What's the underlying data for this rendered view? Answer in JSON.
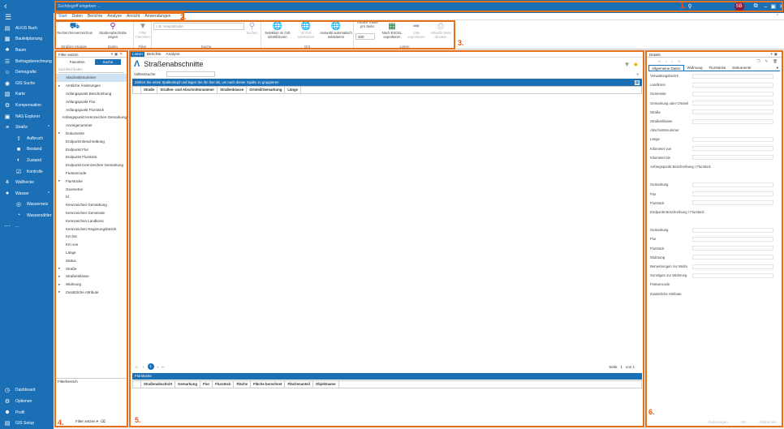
{
  "nav": {
    "items": [
      {
        "icon": "doc",
        "label": "ALKIS Buch"
      },
      {
        "icon": "plan",
        "label": "Bauleitplanung"
      },
      {
        "icon": "tree",
        "label": "Baum"
      },
      {
        "icon": "calc",
        "label": "Beitragsberechnung"
      },
      {
        "icon": "person",
        "label": "Demografie"
      },
      {
        "icon": "pin",
        "label": "GIS Suche"
      },
      {
        "icon": "map",
        "label": "Karte"
      },
      {
        "icon": "gear",
        "label": "Kompensation"
      },
      {
        "icon": "nas",
        "label": "NAS Explorer"
      },
      {
        "icon": "road",
        "label": "Straße",
        "caret": "^"
      },
      {
        "icon": "up",
        "label": "Aufbruch",
        "sub": true
      },
      {
        "icon": "box",
        "label": "Bestand",
        "sub": true
      },
      {
        "icon": "state",
        "label": "Zustand",
        "sub": true
      },
      {
        "icon": "check",
        "label": "Kontrolle",
        "sub": true
      },
      {
        "icon": "hedge",
        "label": "Wallhecke"
      },
      {
        "icon": "drop",
        "label": "Wasser",
        "caret": "^"
      },
      {
        "icon": "net",
        "label": "Wassernetz",
        "sub": true
      },
      {
        "icon": "meter",
        "label": "Wasserzähler",
        "sub": true
      },
      {
        "icon": "more",
        "label": "..."
      }
    ],
    "bottom": [
      {
        "icon": "dash",
        "label": "Dashboard"
      },
      {
        "icon": "opt",
        "label": "Optionen"
      },
      {
        "icon": "prof",
        "label": "Profil"
      },
      {
        "icon": "setup",
        "label": "GIS Setup"
      }
    ]
  },
  "topbar": {
    "search_placeholder": "Suchbegriff eingeben ...",
    "avatar": "SB"
  },
  "menu": [
    "Start",
    "Daten",
    "Berichte",
    "Analyse",
    "Ansicht",
    "Anwendungen"
  ],
  "ribbon": {
    "b_recherche": "Recherchenverzeichnis",
    "b_abschnitte": "Straßenabschnitte zeigen",
    "g_module": "Straßen Module",
    "g_daten": "Daten",
    "b_filter": "Filter Favoriten",
    "g_filter": "Filter",
    "ph_hauptstrasse": "z.B. Hauptstraße",
    "b_suchen": "Suchen",
    "g_suche": "Suche",
    "b_selektion": "Selektion im GIS identifizieren",
    "b_gis_sel": "Im GIS selektieren",
    "b_auswahl": "Auswahl automatisch selektieren",
    "g_gis": "GIS",
    "treffer_label": "Anzahl Treffer pro Seite:",
    "treffer_value": "100",
    "b_excel": "Nach EXCEL exportieren",
    "b_liste": "Liste exportieren",
    "b_drucken": "Aktuelle Seite drucken",
    "g_listen": "Listen"
  },
  "filter": {
    "title": "Filter setzen",
    "tab_fav": "Favoriten",
    "tab_suche": "Suche",
    "search_ph": "Suchfeld finden",
    "items": [
      {
        "label": "Abschnittsnummer",
        "sel": true
      },
      {
        "label": "Amtliche Änderungen",
        "exp": true
      },
      {
        "label": "Anfangspunkt Beschreibung"
      },
      {
        "label": "Anfangspunkt Flur"
      },
      {
        "label": "Anfangspunkt Flurstück"
      },
      {
        "label": "Anfangspunkt Kennzeichen Gemarkung"
      },
      {
        "label": "Anzeigenummer"
      },
      {
        "label": "Dokumente",
        "exp": true
      },
      {
        "label": "Endpunkt Beschreibung"
      },
      {
        "label": "Endpunkt Flur"
      },
      {
        "label": "Endpunkt Flurstück"
      },
      {
        "label": "Endpunkt Kennzeichen Gemarkung"
      },
      {
        "label": "Featurecode"
      },
      {
        "label": "Flurstücke",
        "exp": true
      },
      {
        "label": "Geometrie"
      },
      {
        "label": "Id"
      },
      {
        "label": "Kennzeichen Gemarkung"
      },
      {
        "label": "Kennzeichen Gemeinde"
      },
      {
        "label": "Kennzeichen Landkreis"
      },
      {
        "label": "Kennzeichen Regierungsbezirk"
      },
      {
        "label": "Km bis"
      },
      {
        "label": "Km von"
      },
      {
        "label": "Länge"
      },
      {
        "label": "Status"
      },
      {
        "label": "Straße",
        "exp": true
      },
      {
        "label": "Straßenklasse",
        "exp": true
      },
      {
        "label": "Widmung",
        "exp": true
      },
      {
        "label": "Zusätzliche Attribute",
        "exp": true
      }
    ],
    "filterbereich": "Filterbereich",
    "set_btn": "Filter setzen"
  },
  "main": {
    "tabs": [
      "Listen",
      "Berichte",
      "Analyse"
    ],
    "title": "Straßenabschnitte",
    "volltext": "Volltextsuche",
    "group_hint": "Ziehen Sie einen Spaltenkopf und legen Sie ihn hier ab, um nach dieser Spalte zu gruppieren",
    "columns": [
      "Straße",
      "Straßen- und Abschnittsnummer",
      "Straßenklasse",
      "Ortsteil/Gemarkung",
      "Länge"
    ],
    "pager_page": "1",
    "pager_text": "Seite",
    "pager_of": "von 1",
    "sub_title": "Flurstücke",
    "sub_columns": [
      "Straßenabschnitt",
      "Gemarkung",
      "Flur",
      "Flurstück",
      "Fläche",
      "Fläche berechnet",
      "Flächenanteil",
      "Objektname"
    ]
  },
  "details": {
    "title": "Details",
    "tabs": [
      "Allgemeine Daten",
      "Widmung",
      "Flurstücke",
      "Dokumente"
    ],
    "rows": [
      {
        "label": "Verwaltungsbezirk",
        "f": true
      },
      {
        "label": "Landkreis",
        "f": true
      },
      {
        "label": "Gemeinde",
        "f": true
      },
      {
        "label": "Gemarkung oder Ortsteil",
        "f": true
      },
      {
        "label": "Straße",
        "f": true
      },
      {
        "label": "Straßenklasse",
        "f": true
      },
      {
        "label": "Abschnittsnummer"
      },
      {
        "label": "Länge",
        "f": true
      },
      {
        "label": "Kilometer von",
        "f": true
      },
      {
        "label": "Kilometer bis",
        "f": true
      },
      {
        "label": "Anfangspunkt Beschreibung / Flurstück"
      },
      {
        "label": ""
      },
      {
        "label": "Gemarkung",
        "f": true
      },
      {
        "label": "Flur",
        "f": true
      },
      {
        "label": "Flurstück",
        "f": true
      },
      {
        "label": "Endpunkt Beschreibung / Flurstück"
      },
      {
        "label": ""
      },
      {
        "label": "Gemarkung",
        "f": true
      },
      {
        "label": "Flur",
        "f": true
      },
      {
        "label": "Flurstück",
        "f": true
      },
      {
        "label": "Widmung",
        "f": true
      },
      {
        "label": "Bemerkungen zur Widm",
        "f": true
      },
      {
        "label": "Sonstiges zur Widmung",
        "f": true
      },
      {
        "label": "Featurecode"
      },
      {
        "label": "Zusätzliche Attribute"
      }
    ],
    "btns": [
      "Änderungen",
      "OK",
      "Abbrechen"
    ]
  },
  "markers": [
    "1.",
    "2.",
    "3.",
    "4.",
    "5.",
    "6."
  ],
  "colors": {
    "accent": "#1b6fb5",
    "marker": "#e8701a"
  }
}
